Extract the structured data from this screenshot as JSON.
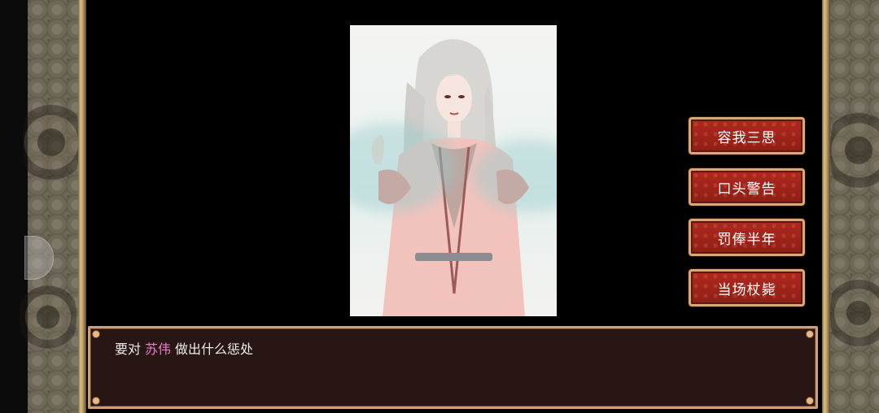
{
  "options": [
    "容我三思",
    "口头警告",
    "罚俸半年",
    "当场杖毙"
  ],
  "dialogue": {
    "prefix": "要对",
    "name": "苏伟",
    "suffix": "做出什么惩处"
  },
  "colors": {
    "option_bg": "#a0241a",
    "option_border": "#d8a878",
    "dialogue_bg": "#271613",
    "name_highlight": "#e67fc4",
    "gold_frame": "#c9a07a"
  }
}
